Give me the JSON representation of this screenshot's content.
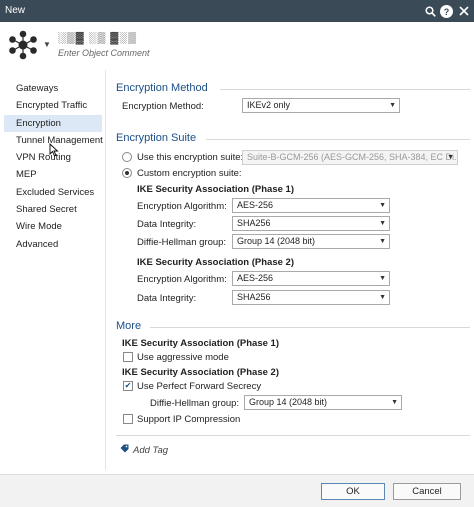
{
  "window": {
    "title": "New"
  },
  "titlebar_icons": {
    "search": "search-icon",
    "help": "?",
    "close": "close-icon"
  },
  "header": {
    "object_name": "░▒▓ ░▒ ▓░▒",
    "comment_placeholder": "Enter Object Comment",
    "logo_icon": "network-cluster-icon"
  },
  "sidebar": {
    "items": [
      {
        "label": "Gateways"
      },
      {
        "label": "Encrypted Traffic"
      },
      {
        "label": "Encryption"
      },
      {
        "label": "Tunnel Management"
      },
      {
        "label": "VPN Routing"
      },
      {
        "label": "MEP"
      },
      {
        "label": "Excluded Services"
      },
      {
        "label": "Shared Secret"
      },
      {
        "label": "Wire Mode"
      },
      {
        "label": "Advanced"
      }
    ],
    "active_index": 2
  },
  "encryption_method": {
    "section_title": "Encryption Method",
    "label": "Encryption Method:",
    "value": "IKEv2 only"
  },
  "encryption_suite": {
    "section_title": "Encryption Suite",
    "use_suite_label": "Use this encryption suite:",
    "use_suite_value": "Suite-B-GCM-256 (AES-GCM-256, SHA-384, EC Di...",
    "custom_label": "Custom encryption suite:",
    "selected": "custom",
    "phase1": {
      "title": "IKE Security Association (Phase 1)",
      "enc_label": "Encryption Algorithm:",
      "enc_value": "AES-256",
      "integrity_label": "Data Integrity:",
      "integrity_value": "SHA256",
      "dh_label": "Diffie-Hellman group:",
      "dh_value": "Group 14 (2048 bit)"
    },
    "phase2": {
      "title": "IKE Security Association (Phase 2)",
      "enc_label": "Encryption Algorithm:",
      "enc_value": "AES-256",
      "integrity_label": "Data Integrity:",
      "integrity_value": "SHA256"
    }
  },
  "more": {
    "section_title": "More",
    "phase1_title": "IKE Security Association (Phase 1)",
    "aggressive_label": "Use aggressive mode",
    "aggressive_checked": false,
    "phase2_title": "IKE Security Association (Phase 2)",
    "pfs_label": "Use Perfect Forward Secrecy",
    "pfs_checked": true,
    "dh_label": "Diffie-Hellman group:",
    "dh_value": "Group 14 (2048 bit)",
    "ip_comp_label": "Support IP Compression",
    "ip_comp_checked": false
  },
  "add_tag": {
    "label": "Add Tag",
    "icon": "tag-icon"
  },
  "footer": {
    "ok_label": "OK",
    "cancel_label": "Cancel"
  },
  "colors": {
    "titlebar": "#3b4a57",
    "section_title": "#1d4f87",
    "active_item": "#dce8f5"
  }
}
